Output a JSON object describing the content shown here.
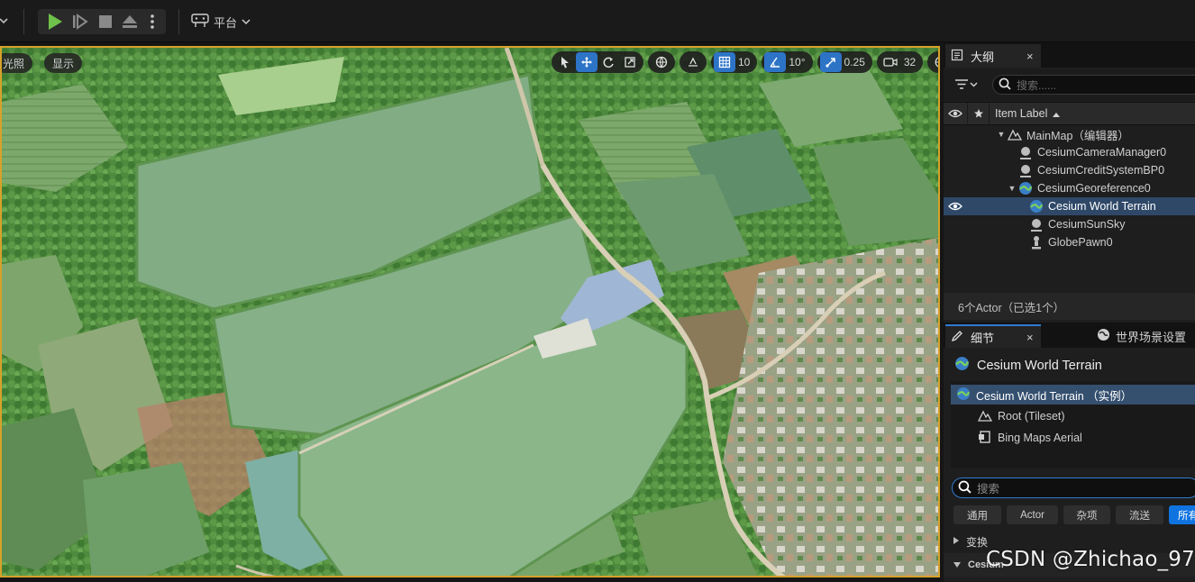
{
  "toolbar": {
    "platform_label": "平台"
  },
  "viewport": {
    "lighting_label": "光照",
    "show_label": "显示",
    "grid_snap_value": "10",
    "rotation_snap_value": "10°",
    "scale_snap_value": "0.25",
    "camera_speed_value": "32"
  },
  "outliner": {
    "tab_label": "大纲",
    "close_label": "×",
    "search_placeholder": "搜索......",
    "column_label": "Item Label",
    "items": [
      {
        "label": "MainMap（编辑器）",
        "icon": "map-icon"
      },
      {
        "label": "CesiumCameraManager0",
        "icon": "actor-icon"
      },
      {
        "label": "CesiumCreditSystemBP0",
        "icon": "actor-icon"
      },
      {
        "label": "CesiumGeoreference0",
        "icon": "globe-icon"
      },
      {
        "label": "Cesium World Terrain",
        "icon": "globe-icon"
      },
      {
        "label": "CesiumSunSky",
        "icon": "actor-icon"
      },
      {
        "label": "GlobePawn0",
        "icon": "pawn-icon"
      }
    ],
    "footer": "6个Actor（已选1个）"
  },
  "details": {
    "tab_label": "细节",
    "close_label": "×",
    "world_settings_label": "世界场景设置",
    "title": "Cesium World Terrain",
    "components": [
      {
        "label": "Cesium World Terrain （实例）"
      },
      {
        "label": "Root (Tileset)"
      },
      {
        "label": "Bing Maps Aerial"
      }
    ],
    "search_placeholder": "搜索",
    "filters": [
      "通用",
      "Actor",
      "杂项",
      "流送",
      "所有"
    ],
    "sections": [
      "变换",
      "Cesium"
    ]
  },
  "watermark": "CSDN @Zhichao_97",
  "colors": {
    "accent_blue": "#0f73e0",
    "selection": "#2f4868",
    "viewport_border": "#d6a22a",
    "play_green": "#6fc24a"
  }
}
